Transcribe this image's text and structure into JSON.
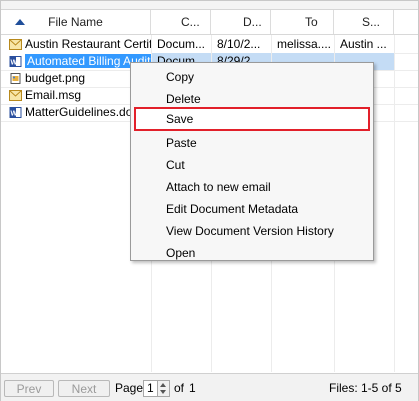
{
  "grid": {
    "columns": [
      {
        "label": "File Name",
        "sort": "ascending"
      },
      {
        "label": "C..."
      },
      {
        "label": "D..."
      },
      {
        "label": "To"
      },
      {
        "label": "S..."
      }
    ],
    "rows": [
      {
        "icon": "email-icon",
        "name": "Austin Restaurant Certifi...",
        "c": "Docum...",
        "d": "8/10/2...",
        "to": "melissa....",
        "s": "Austin ...",
        "selected": false
      },
      {
        "icon": "word-doc-icon",
        "name": "Automated Billing Audits",
        "c": "Docum...",
        "d": "8/29/2...",
        "to": "",
        "s": "",
        "selected": true
      },
      {
        "icon": "image-file-icon",
        "name": "budget.png",
        "c": "",
        "d": "",
        "to": "",
        "s": "",
        "selected": false
      },
      {
        "icon": "email-icon",
        "name": "Email.msg",
        "c": "",
        "d": "",
        "to": "",
        "s": "",
        "selected": false
      },
      {
        "icon": "word-doc-icon",
        "name": "MatterGuidelines.docx",
        "c": "",
        "d": "",
        "to": "",
        "s": "",
        "selected": false
      }
    ]
  },
  "context_menu": {
    "items": [
      {
        "label": "Copy",
        "name": "menu-item-copy"
      },
      {
        "label": "Delete",
        "name": "menu-item-delete"
      },
      {
        "label": "Save",
        "name": "menu-item-save",
        "highlighted": true
      },
      {
        "label": "Paste",
        "name": "menu-item-paste"
      },
      {
        "label": "Cut",
        "name": "menu-item-cut"
      },
      {
        "label": "Attach to new email",
        "name": "menu-item-attach-to-new-email"
      },
      {
        "label": "Edit Document Metadata",
        "name": "menu-item-edit-document-metadata"
      },
      {
        "label": "View Document Version History",
        "name": "menu-item-view-version-history"
      },
      {
        "label": "Open",
        "name": "menu-item-open"
      }
    ]
  },
  "pager": {
    "prev_label": "Prev",
    "next_label": "Next",
    "page_label": "Page",
    "page_value": "1",
    "of_label": "of",
    "total_pages": "1",
    "files_status": "Files: 1-5 of 5"
  },
  "colors": {
    "selection": "#3399ff",
    "highlight_border": "#e2202a",
    "sort_arrow": "#1f4e9a"
  }
}
